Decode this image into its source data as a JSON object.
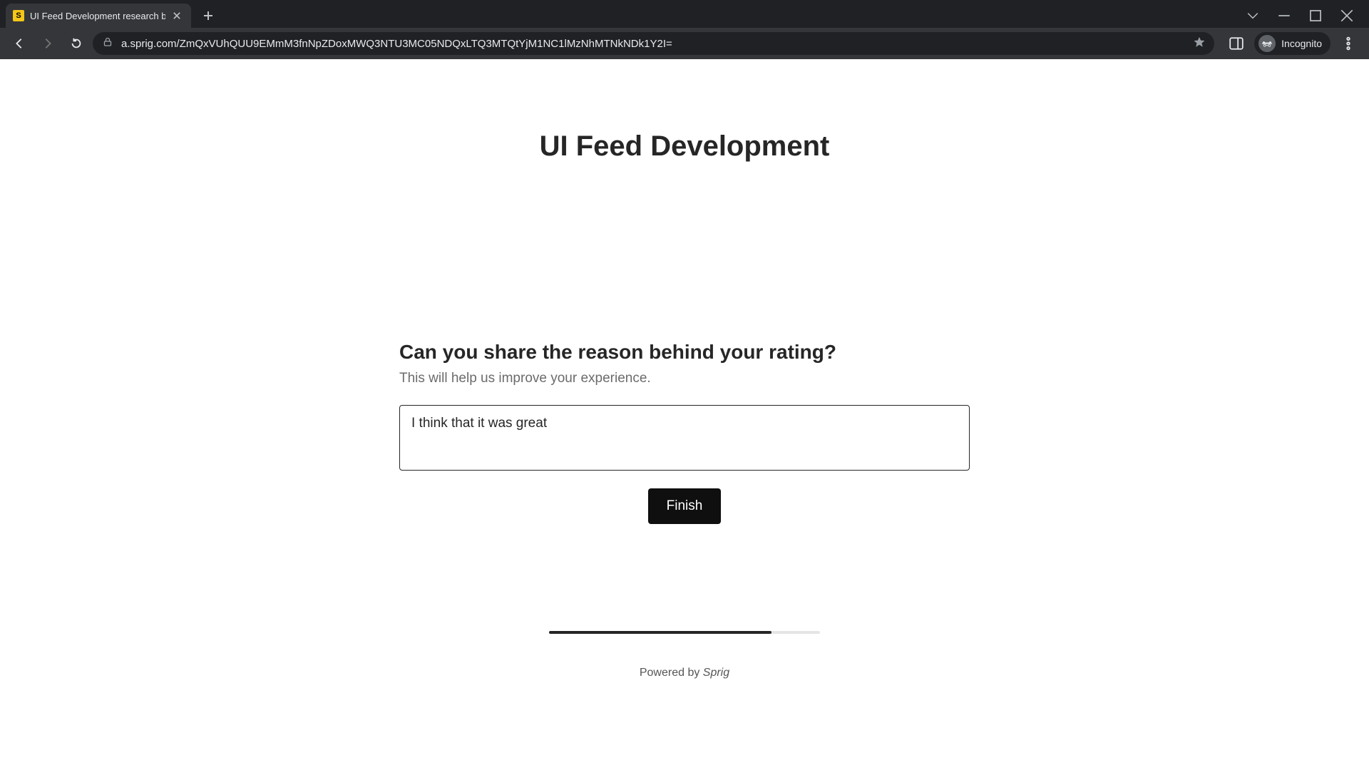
{
  "browser": {
    "tab_title": "UI Feed Development research b",
    "favicon_letter": "S",
    "url": "a.sprig.com/ZmQxVUhQUU9EMmM3fnNpZDoxMWQ3NTU3MC05NDQxLTQ3MTQtYjM1NC1lMzNhMTNkNDk1Y2I=",
    "incognito_label": "Incognito"
  },
  "survey": {
    "title": "UI Feed Development",
    "question": "Can you share the reason behind your rating?",
    "subtext": "This will help us improve your experience.",
    "answer_value": "I think that it was great",
    "finish_label": "Finish",
    "progress_pct": 82,
    "powered_prefix": "Powered by ",
    "powered_brand": "Sprig"
  }
}
